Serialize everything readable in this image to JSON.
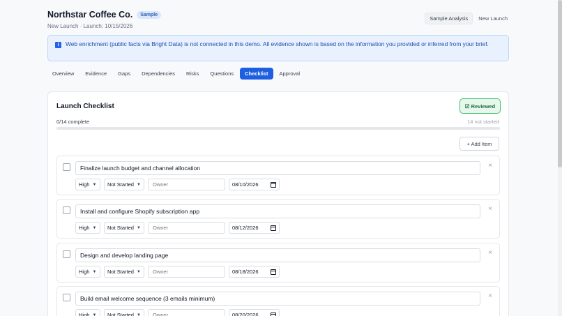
{
  "header": {
    "company": "Northstar Coffee Co.",
    "badge": "Sample",
    "subtitle": "New Launch · Launch: 10/15/2026",
    "sample_analysis_label": "Sample Analysis",
    "new_launch_label": "New Launch"
  },
  "banner": {
    "icon": "info-icon",
    "text": "Web enrichment (public facts via Bright Data) is not connected in this demo. All evidence shown is based on the information you provided or inferred from your brief."
  },
  "tabs": [
    {
      "label": "Overview"
    },
    {
      "label": "Evidence"
    },
    {
      "label": "Gaps"
    },
    {
      "label": "Dependencies"
    },
    {
      "label": "Risks"
    },
    {
      "label": "Questions"
    },
    {
      "label": "Checklist",
      "active": true
    },
    {
      "label": "Approval"
    }
  ],
  "checklist": {
    "title": "Launch Checklist",
    "reviewed_label": "☑ Reviewed",
    "progress_label": "0/14 complete",
    "progress_fraction": 0,
    "not_started_label": "14 not started",
    "add_item_label": "+ Add Item",
    "owner_placeholder": "Owner",
    "close_glyph": "×",
    "items": [
      {
        "title": "Finalize launch budget and channel allocation",
        "priority": "High",
        "status": "Not Started",
        "date": "08/10/2026"
      },
      {
        "title": "Install and configure Shopify subscription app",
        "priority": "High",
        "status": "Not Started",
        "date": "08/12/2026"
      },
      {
        "title": "Design and develop landing page",
        "priority": "High",
        "status": "Not Started",
        "date": "08/18/2026"
      },
      {
        "title": "Build email welcome sequence (3 emails minimum)",
        "priority": "High",
        "status": "Not Started",
        "date": "08/20/2026"
      }
    ]
  },
  "colors": {
    "accent": "#1d5fe0",
    "reviewed_border": "#34c26d",
    "banner_bg": "#e8f1fd"
  }
}
